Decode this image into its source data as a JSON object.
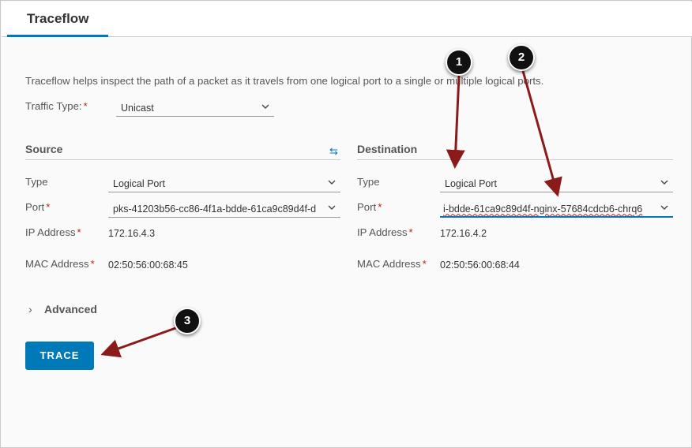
{
  "tab": {
    "label": "Traceflow"
  },
  "description": "Traceflow helps inspect the path of a packet as it travels from one logical port to a single or multiple logical ports.",
  "traffic_type": {
    "label": "Traffic Type:",
    "value": "Unicast"
  },
  "source": {
    "title": "Source",
    "type_label": "Type",
    "type_value": "Logical Port",
    "port_label": "Port",
    "port_value": "pks-41203b56-cc86-4f1a-bdde-61ca9c89d4f-d",
    "ip_label": "IP Address",
    "ip_value": "172.16.4.3",
    "mac_label": "MAC Address",
    "mac_value": "02:50:56:00:68:45"
  },
  "destination": {
    "title": "Destination",
    "type_label": "Type",
    "type_value": "Logical Port",
    "port_label": "Port",
    "port_value": "i-bdde-61ca9c89d4f-nginx-57684cdcb6-chrq6",
    "ip_label": "IP Address",
    "ip_value": "172.16.4.2",
    "mac_label": "MAC Address",
    "mac_value": "02:50:56:00:68:44"
  },
  "advanced": {
    "label": "Advanced"
  },
  "trace_button": {
    "label": "TRACE"
  },
  "callouts": [
    "1",
    "2",
    "3"
  ],
  "colors": {
    "accent": "#0079b8",
    "required": "#c21d00",
    "arrow": "#8b1a1a"
  }
}
